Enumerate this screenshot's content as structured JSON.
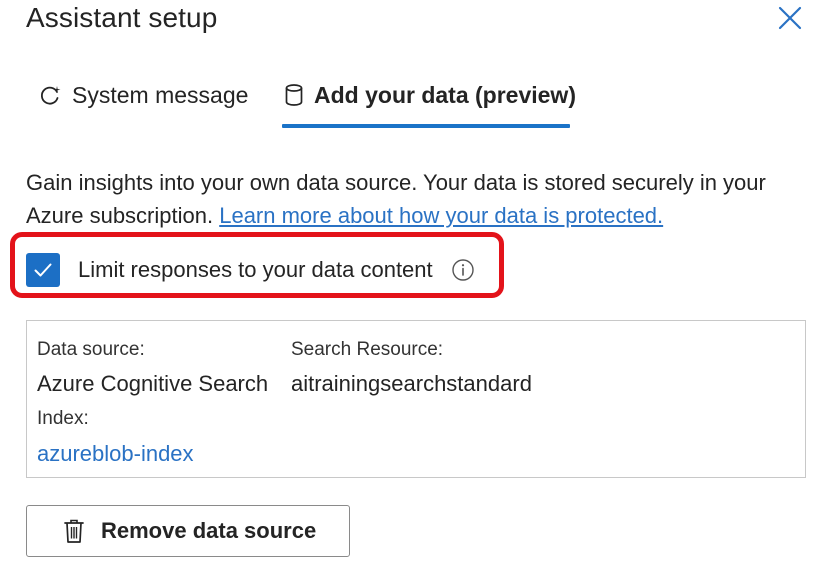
{
  "panel": {
    "title": "Assistant setup",
    "close_icon": "close-icon"
  },
  "tabs": [
    {
      "label": "System message",
      "icon": "sparkle-refresh-icon",
      "selected": false
    },
    {
      "label": "Add your data (preview)",
      "icon": "database-icon",
      "selected": true
    }
  ],
  "description": {
    "text": "Gain insights into your own data source. Your data is stored securely in your Azure subscription.",
    "link": "Learn more about how your data is protected."
  },
  "limit_responses": {
    "label": "Limit responses to your data content",
    "checked": true,
    "info_icon": "info-icon"
  },
  "data_source_card": {
    "data_source_label": "Data source:",
    "data_source_value": "Azure Cognitive Search",
    "search_resource_label": "Search Resource:",
    "search_resource_value": "aitrainingsearchstandard",
    "index_label": "Index:",
    "index_value": "azureblob-index"
  },
  "remove_button": {
    "label": "Remove data source",
    "icon": "trash-icon"
  },
  "colors": {
    "accent": "#1c6fc5",
    "link": "#2a72c4",
    "highlight": "#e3131a"
  }
}
